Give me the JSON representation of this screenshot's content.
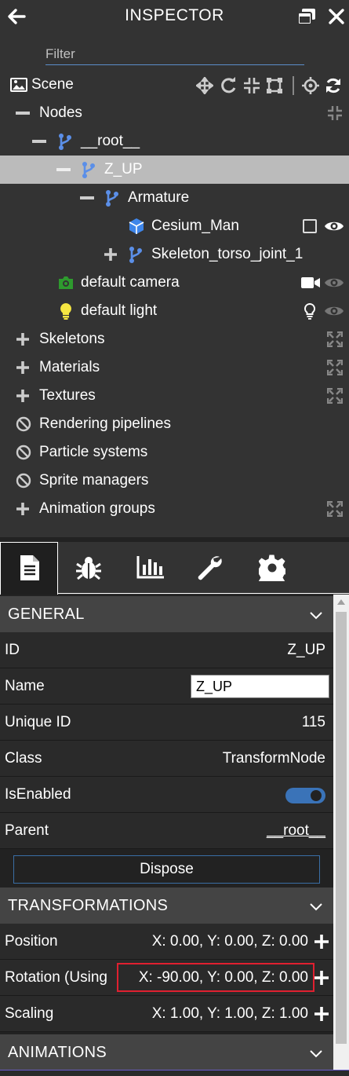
{
  "header": {
    "title": "INSPECTOR",
    "back_icon": "arrow-left-icon",
    "popout_icon": "window-restore-icon",
    "close_icon": "close-icon"
  },
  "filter": {
    "placeholder": "Filter",
    "value": ""
  },
  "scene": {
    "label": "Scene",
    "tools": [
      "move-arrows-icon",
      "rotate-icon",
      "scale-icon",
      "bounding-box-icon",
      "crosshair-icon",
      "refresh-icon"
    ]
  },
  "tree": {
    "nodes_label": "Nodes",
    "root_label": "__root__",
    "zup_label": "Z_UP",
    "armature_label": "Armature",
    "cesium_label": "Cesium_Man",
    "skeleton_joint_label": "Skeleton_torso_joint_1",
    "camera_label": "default camera",
    "light_label": "default light",
    "skeletons_label": "Skeletons",
    "materials_label": "Materials",
    "textures_label": "Textures",
    "rendering_label": "Rendering pipelines",
    "particles_label": "Particle systems",
    "sprites_label": "Sprite managers",
    "animation_groups_label": "Animation groups"
  },
  "tabs": [
    "properties-icon",
    "debug-bug-icon",
    "statistics-chart-icon",
    "tools-wrench-icon",
    "settings-gear-icon"
  ],
  "general": {
    "title": "GENERAL",
    "id_label": "ID",
    "id_value": "Z_UP",
    "name_label": "Name",
    "name_value": "Z_UP",
    "unique_label": "Unique ID",
    "unique_value": "115",
    "class_label": "Class",
    "class_value": "TransformNode",
    "enabled_label": "IsEnabled",
    "enabled_value": true,
    "parent_label": "Parent",
    "parent_value": "__root__",
    "dispose_label": "Dispose"
  },
  "transformations": {
    "title": "TRANSFORMATIONS",
    "position_label": "Position",
    "position_value": "X: 0.00, Y: 0.00, Z: 0.00",
    "rotation_label": "Rotation (Using",
    "rotation_value": "X: -90.00, Y: 0.00, Z: 0.00",
    "scaling_label": "Scaling",
    "scaling_value": "X: 1.00, Y: 1.00, Z: 1.00"
  },
  "animations": {
    "title": "ANIMATIONS"
  },
  "colors": {
    "panel_bg": "#333333",
    "selected_row": "#bbbbbb",
    "node_blue": "#5b8fe8",
    "camera_green": "#2e9a2e",
    "light_yellow": "#f5e642",
    "toggle_blue": "#3a73b8",
    "highlight_red": "#e02030"
  }
}
